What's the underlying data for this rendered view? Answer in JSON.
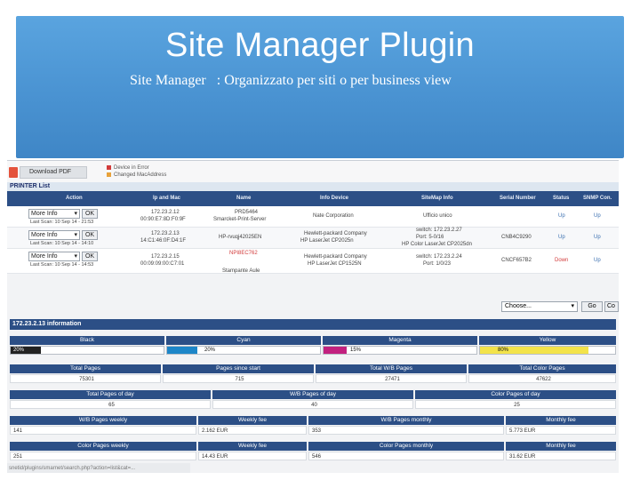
{
  "slide": {
    "title": "Site Manager Plugin",
    "subtitle": "Site Manager   : Organizzato per siti o per business view"
  },
  "toolbar": {
    "download_pdf": "Download PDF",
    "legend": [
      {
        "label": "Device in Error",
        "color": "#d23b3b"
      },
      {
        "label": "Changed MacAddress",
        "color": "#e8a23a"
      }
    ]
  },
  "printer_list": {
    "title": "PRINTER List",
    "columns": [
      "Action",
      "Ip and Mac",
      "Name",
      "Info Device",
      "SiteMap Info",
      "Serial Number",
      "Status",
      "SNMP Con."
    ],
    "action_select": "More Info",
    "ok_label": "OK",
    "rows": [
      {
        "scan": "Last Scan: 10 Sep 14 - 21:53",
        "ip": "172.23.2.12",
        "mac": "00:90:E7:8D:F0:9F",
        "name": "PRD5464",
        "name2": "Smarcket-Print-Server",
        "info": "Nate Corporation",
        "info2": "",
        "site": "Ufficio unico",
        "site2": "",
        "serial": "",
        "status": "Up",
        "snmp": "Up"
      },
      {
        "scan": "Last Scan: 10 Sep 14 - 14:10",
        "ip": "172.23.2.13",
        "mac": "14:C1:46:0F:D4:1F",
        "name": "HP-rvuqj42025EN",
        "name2": "",
        "info": "Hewlett-packard Company",
        "info2": "HP LaserJet CP2025n",
        "site": "switch: 172.23.2.27",
        "site2": "Port: 5-0/16",
        "site3": "HP Color LaserJet CP2025dn",
        "serial": "CNB4C9290",
        "status": "Up",
        "snmp": "Up"
      },
      {
        "scan": "Last Scan: 10 Sep 14 - 14:53",
        "ip": "172.23.2.15",
        "mac": "00:09:09:00:C7:01",
        "name": "NPI8EC762",
        "name2": "Stampante Aule",
        "info": "Hewlett-packard Company",
        "info2": "HP LaserJet CP1525N",
        "site": "switch: 172.23.2.24",
        "site2": "Port: 1/0/23",
        "serial": "CNCF657B2",
        "status": "Down",
        "snmp": "Up"
      }
    ]
  },
  "tools": {
    "choose_label": "Choose...",
    "go_label": "Go",
    "co_label": "Co"
  },
  "info_panel": {
    "title": "172.23.2.13 information",
    "toners": [
      {
        "name": "Black",
        "level": "20%",
        "color": "#222222",
        "fraction": 0.2
      },
      {
        "name": "Cyan",
        "level": "20%",
        "color": "#1d86c8",
        "fraction": 0.2
      },
      {
        "name": "Magenta",
        "level": "15%",
        "color": "#c2217f",
        "fraction": 0.15
      },
      {
        "name": "Yellow",
        "level": "80%",
        "color": "#f3e34a",
        "fraction": 0.8
      }
    ],
    "pages": [
      {
        "label": "Total Pages",
        "value": "75301"
      },
      {
        "label": "Pages since start",
        "value": "715"
      },
      {
        "label": "Total W/B Pages",
        "value": "27471"
      },
      {
        "label": "Total Color Pages",
        "value": "47622"
      }
    ],
    "day": [
      {
        "label": "Total Pages of day",
        "value": "65"
      },
      {
        "label": "W/B Pages of day",
        "value": "40"
      },
      {
        "label": "Color Pages of day",
        "value": "25"
      }
    ],
    "wb_weekly": [
      {
        "label": "W/B Pages weekly",
        "value": "141"
      },
      {
        "label": "Weekly fee",
        "value": "2.162 EUR"
      },
      {
        "label": "W/B Pages monthly",
        "value": "353"
      },
      {
        "label": "Monthly fee",
        "value": "5.773 EUR"
      }
    ],
    "color_weekly": [
      {
        "label": "Color Pages weekly",
        "value": "251"
      },
      {
        "label": "Weekly fee",
        "value": "14.43 EUR"
      },
      {
        "label": "Color Pages monthly",
        "value": "546"
      },
      {
        "label": "Monthly fee",
        "value": "31.62 EUR"
      }
    ]
  },
  "status_url": "snetid/plugins/smarnet/search.php?action=list&cat=..."
}
